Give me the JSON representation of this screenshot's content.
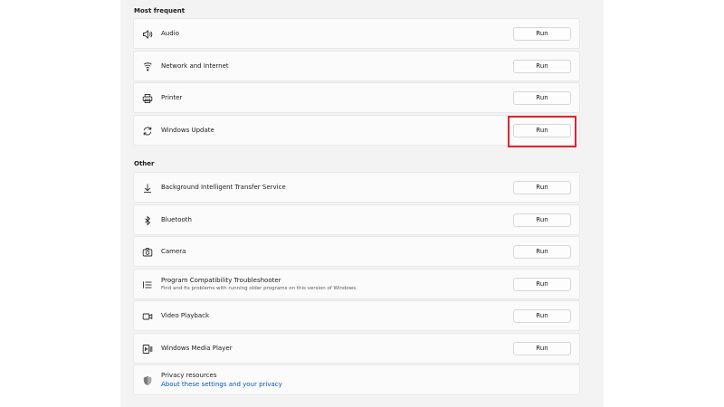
{
  "sections": {
    "most_frequent": "Most frequent",
    "other": "Other"
  },
  "items": {
    "audio": {
      "label": "Audio",
      "button": "Run",
      "icon": "speaker-icon"
    },
    "network": {
      "label": "Network and Internet",
      "button": "Run",
      "icon": "wifi-icon"
    },
    "printer": {
      "label": "Printer",
      "button": "Run",
      "icon": "printer-icon"
    },
    "windows_update": {
      "label": "Windows Update",
      "button": "Run",
      "icon": "refresh-icon"
    },
    "bits": {
      "label": "Background Intelligent Transfer Service",
      "button": "Run",
      "icon": "download-icon"
    },
    "bluetooth": {
      "label": "Bluetooth",
      "button": "Run",
      "icon": "bluetooth-icon"
    },
    "camera": {
      "label": "Camera",
      "button": "Run",
      "icon": "camera-icon"
    },
    "compat": {
      "label": "Program Compatibility Troubleshooter",
      "sublabel": "Find and fix problems with running older programs on this version of Windows.",
      "button": "Run",
      "icon": "list-icon"
    },
    "video": {
      "label": "Video Playback",
      "button": "Run",
      "icon": "video-icon"
    },
    "media_player": {
      "label": "Windows Media Player",
      "button": "Run",
      "icon": "media-player-icon"
    }
  },
  "privacy": {
    "label": "Privacy resources",
    "link": "About these settings and your privacy",
    "icon": "shield-icon"
  },
  "highlight_color": "#e0242c"
}
